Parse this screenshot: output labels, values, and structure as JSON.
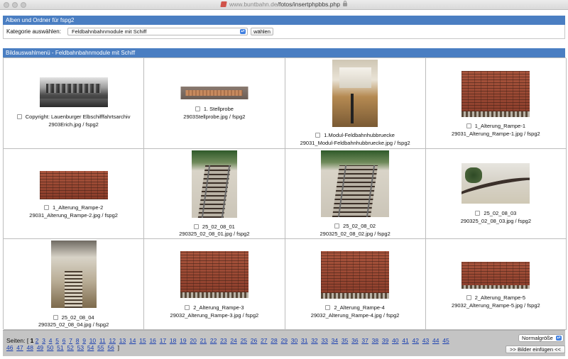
{
  "browser": {
    "url_domain": "www.buntbahn.de",
    "url_path": "/fotos/insertphpbbs.php"
  },
  "albums": {
    "header": "Alben und Ordner für fspg2",
    "category_label": "Kategorie auswählen:",
    "category_value": "Feldbahnbahnmodule mit Schiff",
    "choose_button": "wählen"
  },
  "image_menu": {
    "header": "Bildauswahlmenü - Feldbahnbahnmodule mit Schiff",
    "images": [
      {
        "title": "Copyright: Lauenburger Elbschifffahrtsarchiv",
        "file": "2903Erich.jpg / fspg2",
        "thumb": "bw-photo"
      },
      {
        "title": "1. Stellprobe",
        "file": "2903Stellprobe.jpg / fspg2",
        "thumb": "brick-strip"
      },
      {
        "title": "1.Modul-Feldbahnhubbruecke",
        "file": "29031_Modul-Feldbahnhubbruecke.jpg / fspg2",
        "thumb": "room"
      },
      {
        "title": "1_Alterung_Rampe-1",
        "file": "29031_Alterung_Rampe-1.jpg / fspg2",
        "thumb": "brick"
      },
      {
        "title": "1_Alterung_Rampe-2",
        "file": "29031_Alterung_Rampe-2.jpg / fspg2",
        "thumb": "brick"
      },
      {
        "title": "25_02_08_01",
        "file": "290325_02_08_01.jpg / fspg2",
        "thumb": "track"
      },
      {
        "title": "25_02_08_02",
        "file": "290325_02_08_02.jpg / fspg2",
        "thumb": "track"
      },
      {
        "title": "25_02_08_03",
        "file": "290325_02_08_03.jpg / fspg2",
        "thumb": "curve"
      },
      {
        "title": "25_02_08_04",
        "file": "290325_02_08_04.jpg / fspg2",
        "thumb": "hall"
      },
      {
        "title": "2_Alterung_Rampe-3",
        "file": "29032_Alterung_Rampe-3.jpg / fspg2",
        "thumb": "brick"
      },
      {
        "title": "2_Alterung_Rampe-4",
        "file": "29032_Alterung_Rampe-4.jpg / fspg2",
        "thumb": "brick"
      },
      {
        "title": "2_Alterung_Rampe-5",
        "file": "29032_Alterung_Rampe-5.jpg / fspg2",
        "thumb": "brick"
      }
    ]
  },
  "pagination": {
    "label": "Seiten: [",
    "close": "]",
    "current_page": "1",
    "pages": [
      "2",
      "3",
      "4",
      "5",
      "6",
      "7",
      "8",
      "9",
      "10",
      "11",
      "12",
      "13",
      "14",
      "15",
      "16",
      "17",
      "18",
      "19",
      "20",
      "21",
      "22",
      "23",
      "24",
      "25",
      "26",
      "27",
      "28",
      "29",
      "30",
      "31",
      "32",
      "33",
      "34",
      "35",
      "36",
      "37",
      "38",
      "39",
      "40",
      "41",
      "42",
      "43",
      "44",
      "45",
      "46",
      "47",
      "48",
      "49",
      "50",
      "51",
      "52",
      "53",
      "54",
      "55",
      "56"
    ],
    "size_select": "Normalgröße",
    "insert_button": ">> Bilder einfügen <<"
  },
  "colors": {
    "header_blue": "#4a7ec2",
    "link_blue": "#1a3fb0",
    "pager_gray": "#c4c4c4"
  }
}
